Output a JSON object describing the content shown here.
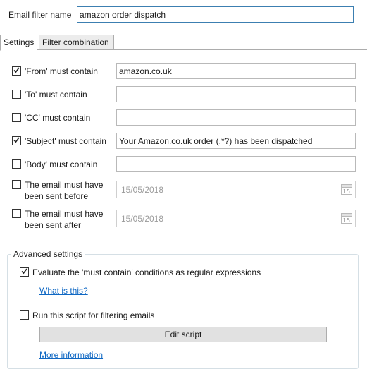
{
  "header": {
    "name_label": "Email filter name",
    "name_value": "amazon order dispatch"
  },
  "tabs": [
    {
      "label": "Settings",
      "active": true
    },
    {
      "label": "Filter combination",
      "active": false
    }
  ],
  "settings": {
    "from": {
      "label": "'From' must contain",
      "checked": true,
      "value": "amazon.co.uk"
    },
    "to": {
      "label": "'To' must contain",
      "checked": false,
      "value": ""
    },
    "cc": {
      "label": "'CC' must contain",
      "checked": false,
      "value": ""
    },
    "subject": {
      "label": "'Subject' must contain",
      "checked": true,
      "value": "Your Amazon.co.uk order (.*?) has been dispatched"
    },
    "body": {
      "label": "'Body' must contain",
      "checked": false,
      "value": ""
    },
    "before": {
      "label_line1": "The email must have",
      "label_line2": "been sent before",
      "checked": false,
      "value": "15/05/2018",
      "calendar_icon": "calendar-icon"
    },
    "after": {
      "label_line1": "The email must have",
      "label_line2": "been sent after",
      "checked": false,
      "value": "15/05/2018",
      "calendar_icon": "calendar-icon"
    }
  },
  "advanced": {
    "title": "Advanced settings",
    "regex": {
      "label": "Evaluate the 'must contain' conditions as regular expressions",
      "checked": true
    },
    "what_is_this": "What is this?",
    "script": {
      "label": "Run this script for filtering emails",
      "checked": false
    },
    "edit_script": "Edit script",
    "more_info": "More information"
  },
  "colors": {
    "accent_border": "#3c7fb1",
    "link": "#0e67c3",
    "button_bg": "#e1e1e1"
  }
}
